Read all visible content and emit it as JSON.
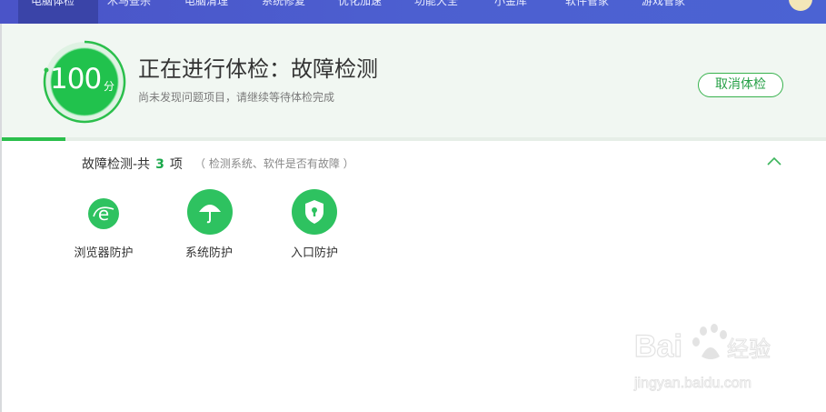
{
  "nav": {
    "tabs": [
      "电脑体检",
      "木马查杀",
      "电脑清理",
      "系统修复",
      "优化加速",
      "功能大全",
      "小金库",
      "软件管家",
      "游戏管家"
    ],
    "active_index": 0
  },
  "score": {
    "value": "100",
    "unit": "分"
  },
  "header": {
    "title": "正在进行体检：故障检测",
    "subtitle": "尚未发现问题项目，请继续等待体检完成",
    "cancel_label": "取消体检",
    "progress": 0.077
  },
  "section": {
    "title_prefix": "故障检测-共",
    "count": "3",
    "title_suffix": "项",
    "note": "（ 检测系统、软件是否有故障 ）"
  },
  "items": [
    {
      "label": "浏览器防护",
      "icon": "browser-e-icon"
    },
    {
      "label": "系统防护",
      "icon": "umbrella-icon"
    },
    {
      "label": "入口防护",
      "icon": "shield-lock-icon"
    }
  ],
  "watermark": {
    "brand": "Bai",
    "brand_suffix": "经验",
    "url": "jingyan.baidu.com"
  },
  "colors": {
    "accent": "#2ec260",
    "nav": "#4c5fd0"
  }
}
